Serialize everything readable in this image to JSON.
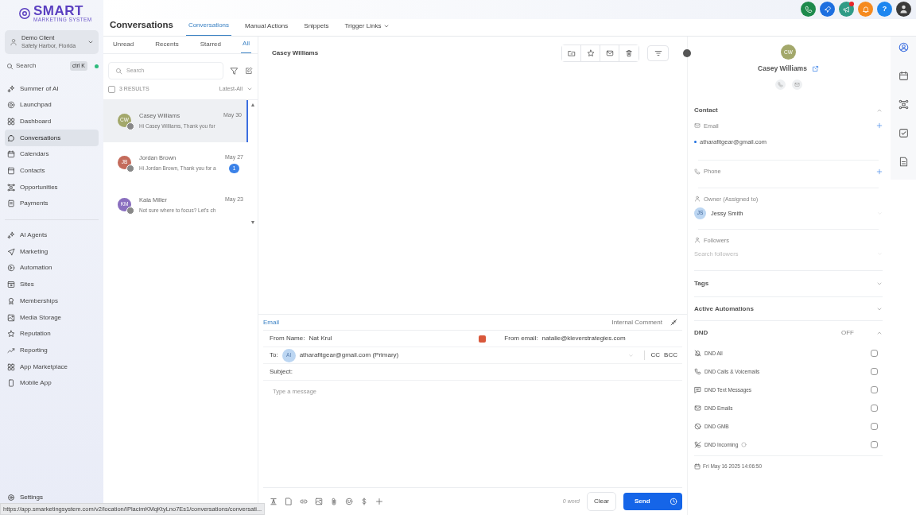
{
  "logo": {
    "title": "SMART",
    "subtitle": "MARKETING SYSTEM"
  },
  "account": {
    "name": "Demo Client",
    "location": "Safety Harbor, Florida"
  },
  "search": {
    "placeholder": "Search",
    "shortcut": "ctrl K"
  },
  "sidebar": {
    "groups": [
      [
        {
          "label": "Summer of AI",
          "kind": "sparkle",
          "selected": false
        },
        {
          "label": "Launchpad",
          "kind": "target",
          "selected": false
        },
        {
          "label": "Dashboard",
          "kind": "grid",
          "selected": false
        },
        {
          "label": "Conversations",
          "kind": "chat",
          "selected": true
        },
        {
          "label": "Calendars",
          "kind": "calendar",
          "selected": false
        },
        {
          "label": "Contacts",
          "kind": "card",
          "selected": false
        },
        {
          "label": "Opportunities",
          "kind": "nodes",
          "selected": false
        },
        {
          "label": "Payments",
          "kind": "receipt",
          "selected": false
        }
      ],
      [
        {
          "label": "AI Agents",
          "kind": "sparkle",
          "selected": false
        },
        {
          "label": "Marketing",
          "kind": "plane",
          "selected": false
        },
        {
          "label": "Automation",
          "kind": "play",
          "selected": false
        },
        {
          "label": "Sites",
          "kind": "window",
          "selected": false
        },
        {
          "label": "Memberships",
          "kind": "ribbon",
          "selected": false
        },
        {
          "label": "Media Storage",
          "kind": "image",
          "selected": false
        },
        {
          "label": "Reputation",
          "kind": "star",
          "selected": false
        },
        {
          "label": "Reporting",
          "kind": "trend",
          "selected": false
        },
        {
          "label": "App Marketplace",
          "kind": "grid",
          "selected": false
        },
        {
          "label": "Mobile App",
          "kind": "mobile",
          "selected": false
        }
      ]
    ],
    "settings": "Settings"
  },
  "top_icons": [
    {
      "kind": "phone",
      "color": "#1e8a4c"
    },
    {
      "kind": "rocket",
      "color": "#1d6fe0"
    },
    {
      "kind": "megaphone",
      "color": "#2f9b86",
      "badge": true
    },
    {
      "kind": "bell",
      "color": "#f58a1f"
    },
    {
      "kind": "help",
      "color": "#1d86f0",
      "label": "?"
    },
    {
      "kind": "avatar",
      "color": "#3a3a3a"
    }
  ],
  "header": {
    "title": "Conversations",
    "tabs": [
      {
        "label": "Conversations",
        "selected": true,
        "dropdown": false
      },
      {
        "label": "Manual Actions",
        "selected": false,
        "dropdown": false
      },
      {
        "label": "Snippets",
        "selected": false,
        "dropdown": false
      },
      {
        "label": "Trigger Links",
        "selected": false,
        "dropdown": true
      }
    ]
  },
  "list": {
    "filters": [
      {
        "label": "Unread",
        "selected": false
      },
      {
        "label": "Recents",
        "selected": false
      },
      {
        "label": "Starred",
        "selected": false
      },
      {
        "label": "All",
        "selected": true
      }
    ],
    "search_placeholder": "Search",
    "select_all_checked": false,
    "results": "3 RESULTS",
    "sort": "Latest-All",
    "scroll_up": "▲",
    "scroll_down": "▼",
    "conversations": [
      {
        "initials": "CW",
        "name": "Casey Williams",
        "preview": "Hi Casey Williams, Thank you for",
        "date": "May 30",
        "color": "#a3a86b",
        "selected": true
      },
      {
        "initials": "JB",
        "name": "Jordan Brown",
        "preview": "Hi Jordan Brown, Thank you for a",
        "date": "May 27",
        "color": "#c46b5b",
        "unread": "1",
        "selected": false
      },
      {
        "initials": "KM",
        "name": "Kala Miller",
        "preview": "Not sure where to focus? Let's ch",
        "date": "May 23",
        "color": "#8a6fbf",
        "selected": false
      }
    ]
  },
  "chat": {
    "contact_name": "Casey Williams"
  },
  "composer": {
    "channel": "Email",
    "internal": "Internal Comment",
    "from_name_label": "From Name:",
    "from_name": "Nat Krul",
    "from_email_label": "From email:",
    "from_email": "natalie@kleverstrategies.com",
    "to_label": "To:",
    "to_initials": "AI",
    "to": "atharafitgear@gmail.com (Primary)",
    "cc": "CC",
    "bcc": "BCC",
    "subject_label": "Subject:",
    "placeholder": "Type a message",
    "word_count": "0 word",
    "clear": "Clear",
    "send": "Send"
  },
  "contact": {
    "initials": "CW",
    "name": "Casey Williams",
    "section": "Contact",
    "email_label": "Email",
    "email": "atharafitgear@gmail.com",
    "phone_label": "Phone",
    "owner_label": "Owner (Assigned to)",
    "owner_initials": "JS",
    "owner": "Jessy Smith",
    "followers_label": "Followers",
    "followers_placeholder": "Search followers",
    "tags": "Tags",
    "automations": "Active Automations",
    "dnd": {
      "title": "DND",
      "status": "OFF",
      "items": [
        {
          "label": "DND All",
          "kind": "belloff",
          "checked": false
        },
        {
          "label": "DND Calls & Voicemails",
          "kind": "phone",
          "checked": false
        },
        {
          "label": "DND Text Messages",
          "kind": "message",
          "checked": false
        },
        {
          "label": "DND Emails",
          "kind": "mail",
          "checked": false
        },
        {
          "label": "DND GMB",
          "kind": "ban",
          "checked": false
        },
        {
          "label": "DND Incoming",
          "kind": "phoneoff",
          "checked": false,
          "info": true
        }
      ]
    },
    "date": "Fri May 16 2025 14:06:50"
  },
  "rail": [
    {
      "kind": "user",
      "selected": true
    },
    {
      "kind": "calendar",
      "selected": false
    },
    {
      "kind": "nodes",
      "selected": false
    },
    {
      "kind": "checkbox",
      "selected": false
    },
    {
      "kind": "doc",
      "selected": false
    }
  ],
  "status_url": "https://app.smarketingsystem.com/v2/location/IPlacimKMqKtyLno7Es1/conversations/conversati..."
}
